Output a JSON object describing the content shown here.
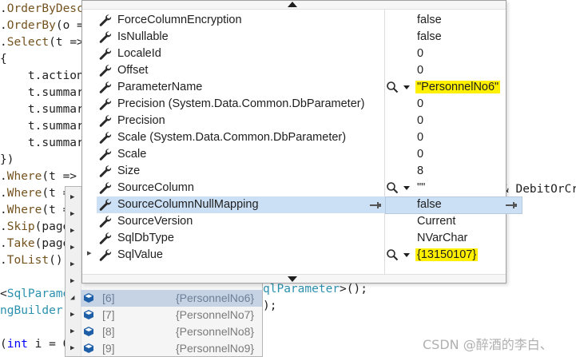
{
  "code_lines": [
    {
      "seg": [
        {
          "c": ".",
          "cls": ""
        },
        {
          "c": "OrderByDesc",
          "cls": "m"
        }
      ]
    },
    {
      "seg": [
        {
          "c": ".",
          "cls": ""
        },
        {
          "c": "OrderBy",
          "cls": "m"
        },
        {
          "c": "(o =",
          "cls": ""
        }
      ]
    },
    {
      "seg": [
        {
          "c": ".",
          "cls": ""
        },
        {
          "c": "Select",
          "cls": "m"
        },
        {
          "c": "(t =>",
          "cls": ""
        }
      ]
    },
    {
      "seg": [
        {
          "c": "{",
          "cls": ""
        }
      ]
    },
    {
      "seg": [
        {
          "c": "    t.",
          "cls": ""
        },
        {
          "c": "action",
          "cls": ""
        }
      ]
    },
    {
      "seg": [
        {
          "c": "    t.",
          "cls": ""
        },
        {
          "c": "summar",
          "cls": ""
        }
      ]
    },
    {
      "seg": [
        {
          "c": "    t.",
          "cls": ""
        },
        {
          "c": "summar",
          "cls": ""
        }
      ]
    },
    {
      "seg": [
        {
          "c": "    t.",
          "cls": ""
        },
        {
          "c": "summar",
          "cls": ""
        }
      ]
    },
    {
      "seg": [
        {
          "c": "    t.",
          "cls": ""
        },
        {
          "c": "summar",
          "cls": ""
        }
      ]
    },
    {
      "seg": [
        {
          "c": "})",
          "cls": ""
        }
      ]
    },
    {
      "seg": [
        {
          "c": ".",
          "cls": ""
        },
        {
          "c": "Where",
          "cls": "m"
        },
        {
          "c": "(t =>",
          "cls": ""
        }
      ]
    },
    {
      "seg": [
        {
          "c": ".",
          "cls": ""
        },
        {
          "c": "Where",
          "cls": "m"
        },
        {
          "c": "(t =",
          "cls": ""
        }
      ]
    },
    {
      "seg": [
        {
          "c": ".",
          "cls": ""
        },
        {
          "c": "Where",
          "cls": "m"
        },
        {
          "c": "(t =",
          "cls": ""
        }
      ]
    },
    {
      "seg": [
        {
          "c": ".",
          "cls": ""
        },
        {
          "c": "Skip",
          "cls": "m"
        },
        {
          "c": "(page",
          "cls": ""
        }
      ]
    },
    {
      "seg": [
        {
          "c": ".",
          "cls": ""
        },
        {
          "c": "Take",
          "cls": "m"
        },
        {
          "c": "(page",
          "cls": ""
        }
      ]
    },
    {
      "seg": [
        {
          "c": ".",
          "cls": ""
        },
        {
          "c": "ToList",
          "cls": "m"
        },
        {
          "c": "();",
          "cls": ""
        }
      ]
    },
    {
      "seg": [
        {
          "c": "",
          "cls": ""
        }
      ]
    },
    {
      "seg": [
        {
          "c": "<",
          "cls": ""
        },
        {
          "c": "SqlParame",
          "cls": "t"
        }
      ]
    },
    {
      "seg": [
        {
          "c": "ngBuilder",
          "cls": "t"
        }
      ]
    },
    {
      "seg": [
        {
          "c": "",
          "cls": ""
        }
      ]
    },
    {
      "seg": [
        {
          "c": "(",
          "cls": ""
        },
        {
          "c": "int",
          "cls": "k"
        },
        {
          "c": " i = 0",
          "cls": ""
        }
      ]
    }
  ],
  "code_right": {
    "line12": "& DebitOrCr",
    "line18a": "qlParameter",
    "line18b": ">();",
    "line19": ");"
  },
  "list": {
    "rows": [
      {
        "index": "[6]",
        "value": "{PersonnelNo6}",
        "selected": true
      },
      {
        "index": "[7]",
        "value": "{PersonnelNo7}",
        "selected": false
      },
      {
        "index": "[8]",
        "value": "{PersonnelNo8}",
        "selected": false
      },
      {
        "index": "[9]",
        "value": "{PersonnelNo9}",
        "selected": false
      }
    ]
  },
  "properties": [
    {
      "name": "ForceColumnEncryption",
      "value": "false"
    },
    {
      "name": "IsNullable",
      "value": "false"
    },
    {
      "name": "LocaleId",
      "value": "0"
    },
    {
      "name": "Offset",
      "value": "0"
    },
    {
      "name": "ParameterName",
      "value": "\"PersonnelNo6\"",
      "search": true,
      "highlight": true
    },
    {
      "name": "Precision (System.Data.Common.DbParameter)",
      "value": "0"
    },
    {
      "name": "Precision",
      "value": "0"
    },
    {
      "name": "Scale (System.Data.Common.DbParameter)",
      "value": "0"
    },
    {
      "name": "Scale",
      "value": "0"
    },
    {
      "name": "Size",
      "value": "8"
    },
    {
      "name": "SourceColumn",
      "value": "\"\"",
      "search": true
    },
    {
      "name": "SourceColumnNullMapping",
      "value": "false",
      "selected": true
    },
    {
      "name": "SourceVersion",
      "value": "Current"
    },
    {
      "name": "SqlDbType",
      "value": "NVarChar"
    },
    {
      "name": "SqlValue",
      "value": "{13150107}",
      "search": true,
      "highlight": true,
      "expandable": true
    }
  ],
  "watermark": "CSDN @醉酒的李白、",
  "colors": {
    "highlight": "#fff000",
    "selected_row": "#cce0f5"
  }
}
